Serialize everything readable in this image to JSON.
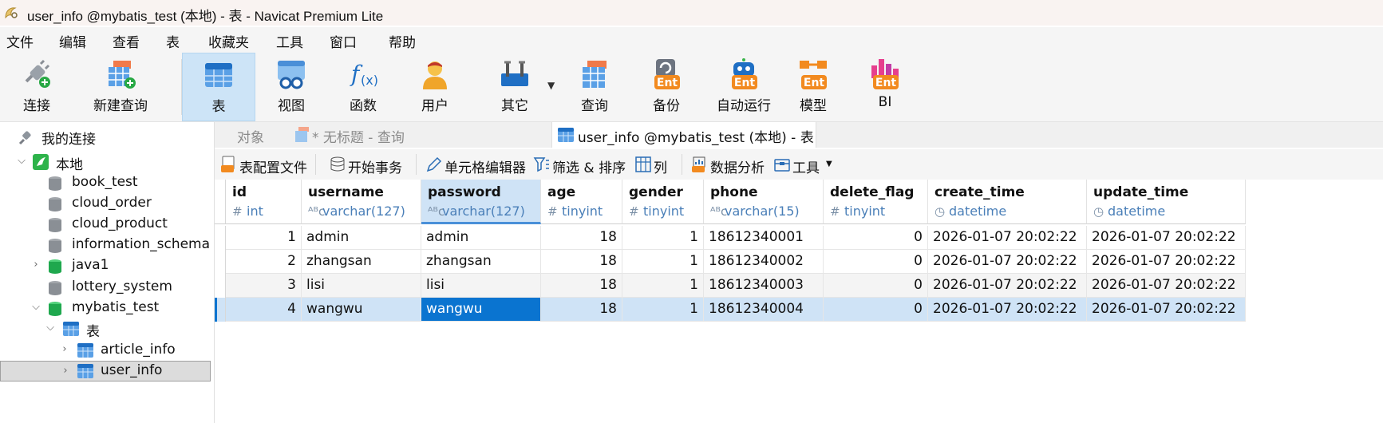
{
  "window": {
    "title": "user_info @mybatis_test (本地) - 表 - Navicat Premium Lite",
    "icon": "navicat-app-icon"
  },
  "menu": [
    "文件",
    "编辑",
    "查看",
    "表",
    "收藏夹",
    "工具",
    "窗口",
    "帮助"
  ],
  "toolbar": {
    "connect": "连接",
    "new_query": "新建查询",
    "table": "表",
    "view": "视图",
    "function": "函数",
    "user": "用户",
    "other": "其它",
    "query": "查询",
    "backup": "备份",
    "automation": "自动运行",
    "model": "模型",
    "bi": "BI",
    "ent_badge": "Ent"
  },
  "tree": {
    "root": "我的连接",
    "connection": "本地",
    "databases": [
      "book_test",
      "cloud_order",
      "cloud_product",
      "information_schema",
      "java1",
      "lottery_system",
      "mybatis_test"
    ],
    "tables_folder": "表",
    "tables": [
      "article_info",
      "user_info"
    ]
  },
  "tabs": {
    "objects": "对象",
    "untitled": "* 无标题 - 查询",
    "current": "user_info @mybatis_test (本地) - 表"
  },
  "subtoolbar": {
    "profile": "表配置文件",
    "begin_tx": "开始事务",
    "cell_editor": "单元格编辑器",
    "filter_sort": "筛选 & 排序",
    "columns": "列",
    "analysis": "数据分析",
    "tools": "工具"
  },
  "columns": [
    {
      "name": "id",
      "type": "int",
      "type_icon": "#"
    },
    {
      "name": "username",
      "type": "varchar(127)",
      "type_icon": "ᴬᴮc"
    },
    {
      "name": "password",
      "type": "varchar(127)",
      "type_icon": "ᴬᴮc"
    },
    {
      "name": "age",
      "type": "tinyint",
      "type_icon": "#"
    },
    {
      "name": "gender",
      "type": "tinyint",
      "type_icon": "#"
    },
    {
      "name": "phone",
      "type": "varchar(15)",
      "type_icon": "ᴬᴮc"
    },
    {
      "name": "delete_flag",
      "type": "tinyint",
      "type_icon": "#"
    },
    {
      "name": "create_time",
      "type": "datetime",
      "type_icon": "◷"
    },
    {
      "name": "update_time",
      "type": "datetime",
      "type_icon": "◷"
    }
  ],
  "rows": [
    [
      "1",
      "admin",
      "admin",
      "18",
      "1",
      "18612340001",
      "0",
      "2026-01-07 20:02:22",
      "2026-01-07 20:02:22"
    ],
    [
      "2",
      "zhangsan",
      "zhangsan",
      "18",
      "1",
      "18612340002",
      "0",
      "2026-01-07 20:02:22",
      "2026-01-07 20:02:22"
    ],
    [
      "3",
      "lisi",
      "lisi",
      "18",
      "1",
      "18612340003",
      "0",
      "2026-01-07 20:02:22",
      "2026-01-07 20:02:22"
    ],
    [
      "4",
      "wangwu",
      "wangwu",
      "18",
      "1",
      "18612340004",
      "0",
      "2026-01-07 20:02:22",
      "2026-01-07 20:02:22"
    ]
  ],
  "colors": {
    "accent": "#0a74d0",
    "selection": "#cfe3f6",
    "type_text": "#4a7fb8",
    "ent_orange": "#f28a1f"
  }
}
